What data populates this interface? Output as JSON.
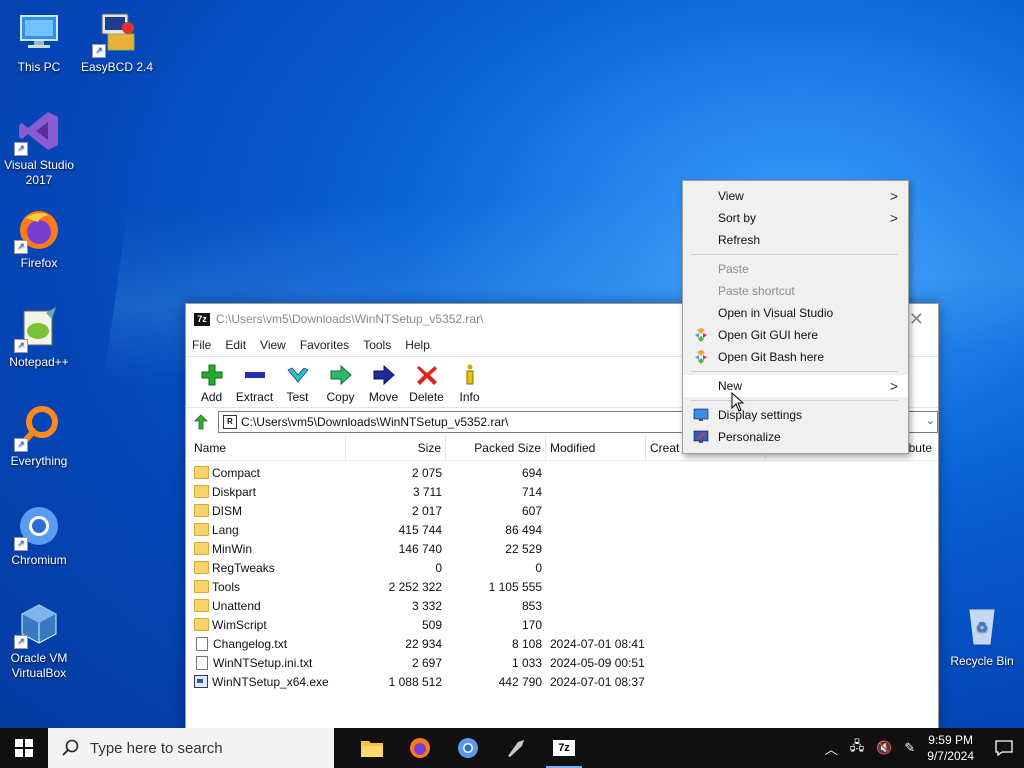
{
  "desktop": {
    "icons": [
      {
        "label": "This PC"
      },
      {
        "label": "EasyBCD 2.4"
      },
      {
        "label": "Visual Studio 2017"
      },
      {
        "label": "Firefox"
      },
      {
        "label": "Notepad++"
      },
      {
        "label": "Everything"
      },
      {
        "label": "Chromium"
      },
      {
        "label": "Oracle VM VirtualBox"
      }
    ],
    "recycle_bin": "Recycle Bin"
  },
  "window": {
    "title": "C:\\Users\\vm5\\Downloads\\WinNTSetup_v5352.rar\\",
    "title_icon": "7z",
    "menu": [
      "File",
      "Edit",
      "View",
      "Favorites",
      "Tools",
      "Help"
    ],
    "toolbar": [
      "Add",
      "Extract",
      "Test",
      "Copy",
      "Move",
      "Delete",
      "Info"
    ],
    "address": "C:\\Users\\vm5\\Downloads\\WinNTSetup_v5352.rar\\",
    "columns": [
      "Name",
      "Size",
      "Packed Size",
      "Modified",
      "Creat",
      "ibute"
    ],
    "rows": [
      {
        "type": "folder",
        "name": "Compact",
        "size": "2 075",
        "packed": "694",
        "modified": ""
      },
      {
        "type": "folder",
        "name": "Diskpart",
        "size": "3 711",
        "packed": "714",
        "modified": ""
      },
      {
        "type": "folder",
        "name": "DISM",
        "size": "2 017",
        "packed": "607",
        "modified": ""
      },
      {
        "type": "folder",
        "name": "Lang",
        "size": "415 744",
        "packed": "86 494",
        "modified": ""
      },
      {
        "type": "folder",
        "name": "MinWin",
        "size": "146 740",
        "packed": "22 529",
        "modified": ""
      },
      {
        "type": "folder",
        "name": "RegTweaks",
        "size": "0",
        "packed": "0",
        "modified": ""
      },
      {
        "type": "folder",
        "name": "Tools",
        "size": "2 252 322",
        "packed": "1 105 555",
        "modified": ""
      },
      {
        "type": "folder",
        "name": "Unattend",
        "size": "3 332",
        "packed": "853",
        "modified": ""
      },
      {
        "type": "folder",
        "name": "WimScript",
        "size": "509",
        "packed": "170",
        "modified": ""
      },
      {
        "type": "file",
        "name": "Changelog.txt",
        "size": "22 934",
        "packed": "8 108",
        "modified": "2024-07-01 08:41"
      },
      {
        "type": "file",
        "name": "WinNTSetup.ini.txt",
        "size": "2 697",
        "packed": "1 033",
        "modified": "2024-05-09 00:51"
      },
      {
        "type": "exe",
        "name": "WinNTSetup_x64.exe",
        "size": "1 088 512",
        "packed": "442 790",
        "modified": "2024-07-01 08:37"
      }
    ]
  },
  "context_menu": {
    "items": [
      {
        "label": "View",
        "arrow": ">"
      },
      {
        "label": "Sort by",
        "arrow": ">"
      },
      {
        "label": "Refresh"
      },
      {
        "label": "Paste"
      },
      {
        "label": "Paste shortcut"
      },
      {
        "label": "Open in Visual Studio"
      },
      {
        "label": "Open Git GUI here"
      },
      {
        "label": "Open Git Bash here"
      },
      {
        "label": "New",
        "arrow": ">"
      },
      {
        "label": "Display settings"
      },
      {
        "label": "Personalize"
      }
    ]
  },
  "taskbar": {
    "search_placeholder": "Type here to search",
    "time": "9:59 PM",
    "date": "9/7/2024",
    "apps": [
      "file-explorer-icon",
      "firefox-icon",
      "chromium-icon",
      "app-icon",
      "7zip-icon"
    ],
    "app_7z_label": "7z"
  },
  "colors": {
    "accent": "#0a63d6",
    "taskbar": "#101010",
    "menu_bg": "#f0f0f0"
  }
}
